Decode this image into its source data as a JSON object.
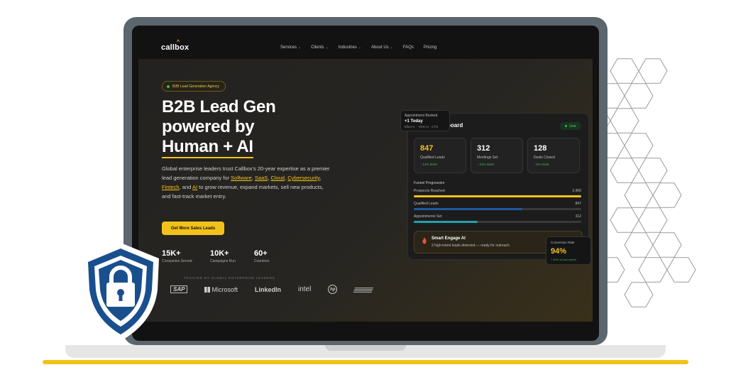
{
  "nav": {
    "logo": "callbox",
    "items": [
      "Services",
      "Clients",
      "Industries",
      "About Us",
      "FAQs",
      "Pricing"
    ]
  },
  "hero": {
    "badge": "B2B Lead Generation Agency",
    "headline_1": "B2B Lead Gen",
    "headline_2": "powered by",
    "headline_3": "Human + AI",
    "desc_a": "Global enterprise leaders trust Callbox's 20-year expertise as a premier lead generation company for ",
    "link_software": "Software",
    "link_saas": "SaaS",
    "link_cloud": "Cloud",
    "link_cyber": "Cybersecurity",
    "link_fintech": "Fintech",
    "and": "and",
    "link_ai": "AI",
    "desc_b": " to grow revenue, expand markets, sell new products, and fast-track market entry.",
    "cta": "Get More Sales Leads"
  },
  "stats": [
    {
      "value": "15K+",
      "label": "Companies Served"
    },
    {
      "value": "10K+",
      "label": "Campaigns Run"
    },
    {
      "value": "60+",
      "label": "Countries"
    }
  ],
  "trusted_by": "TRUSTED BY GLOBAL ENTERPRISE LEADERS",
  "client_logos": [
    "SAP",
    "Microsoft",
    "LinkedIn",
    "intel",
    "hp"
  ],
  "dashboard": {
    "title_partial": "board",
    "live": "Live",
    "cards": [
      {
        "value": "847",
        "label": "Qualified Leads",
        "delta": "↑ 12% MoM"
      },
      {
        "value": "312",
        "label": "Meetings Set",
        "delta": "↑ 24% MoM"
      },
      {
        "value": "128",
        "label": "Deals Closed",
        "delta": "↑ 8% MoM"
      }
    ],
    "funnel_title": "Funnel Progression",
    "funnel": [
      {
        "label": "Prospects Reached",
        "value": "2,400",
        "fraction": 1.0,
        "color": "#f2c21b"
      },
      {
        "label": "Qualified Leads",
        "value": "847",
        "fraction": 0.65,
        "color": "#1e5a9e"
      },
      {
        "label": "Appointments Set",
        "value": "312",
        "fraction": 0.38,
        "color": "#26a0a8"
      }
    ],
    "smart_title": "Smart Engage AI",
    "smart_sub": "3 high-intent leads detected — ready for outreach"
  },
  "appointment": {
    "title": "Appointment Booked",
    "count": "+1 Today",
    "detail": "Ellen K. · VDS AI · CTO"
  },
  "conversion": {
    "label": "Conversion Rate",
    "value": "94%",
    "delta": "↑ 30% vs last month"
  },
  "colors": {
    "accent": "#f2c21b",
    "shield": "#1a4f8e",
    "positive": "#3fb950"
  }
}
